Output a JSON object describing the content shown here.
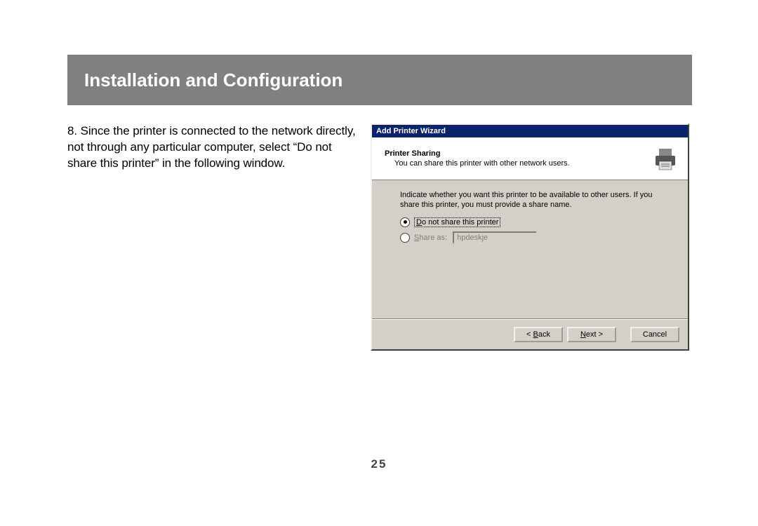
{
  "header": {
    "title": "Installation and Configuration"
  },
  "instruction": {
    "text": "8. Since the printer is connected to the network directly, not through any particular computer, select “Do not share this printer” in the following window."
  },
  "wizard": {
    "window_title": "Add Printer Wizard",
    "section_title": "Printer Sharing",
    "section_subtitle": "You can share this printer with other network users.",
    "body_text": "Indicate whether you want this printer to be available to other users. If you share this printer, you must provide a share name.",
    "option_noshare": {
      "label": "Do not share this printer",
      "selected": true
    },
    "option_share": {
      "label": "Share as:",
      "value": "hpdeskje",
      "selected": false
    },
    "buttons": {
      "back": "< Back",
      "next": "Next >",
      "cancel": "Cancel"
    }
  },
  "page_number": "25"
}
